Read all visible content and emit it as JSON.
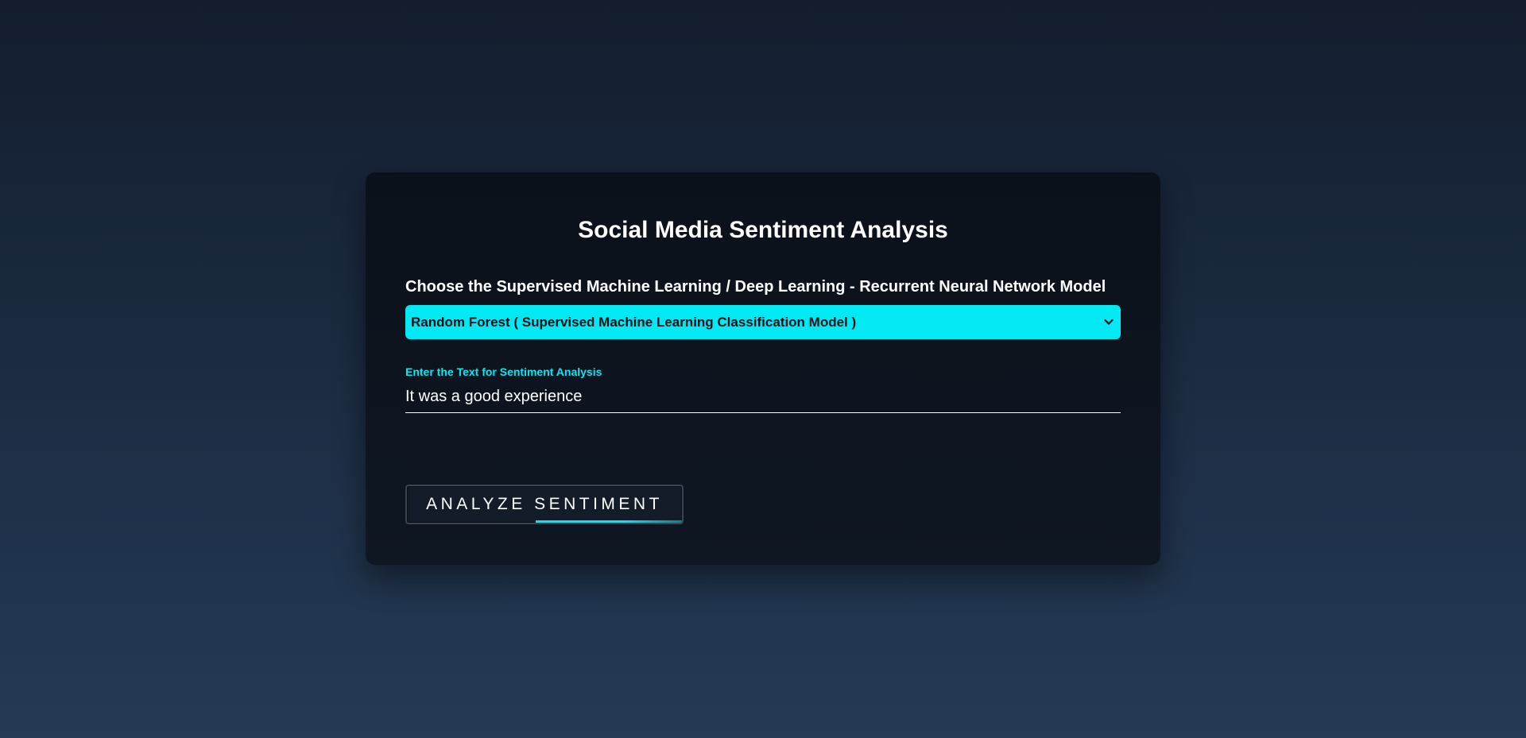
{
  "card": {
    "title": "Social Media Sentiment Analysis"
  },
  "model": {
    "label": "Choose the Supervised Machine Learning / Deep Learning - Recurrent Neural Network Model",
    "selected": "Random Forest ( Supervised Machine Learning Classification Model )"
  },
  "text_input": {
    "label": "Enter the Text for Sentiment Analysis",
    "value": "It was a good experience"
  },
  "button": {
    "label": "ANALYZE SENTIMENT"
  },
  "colors": {
    "accent": "#03e9f4",
    "card_bg": "#0b111a",
    "text": "#ffffff"
  },
  "icons": {
    "dropdown": "chevron-down-icon"
  }
}
